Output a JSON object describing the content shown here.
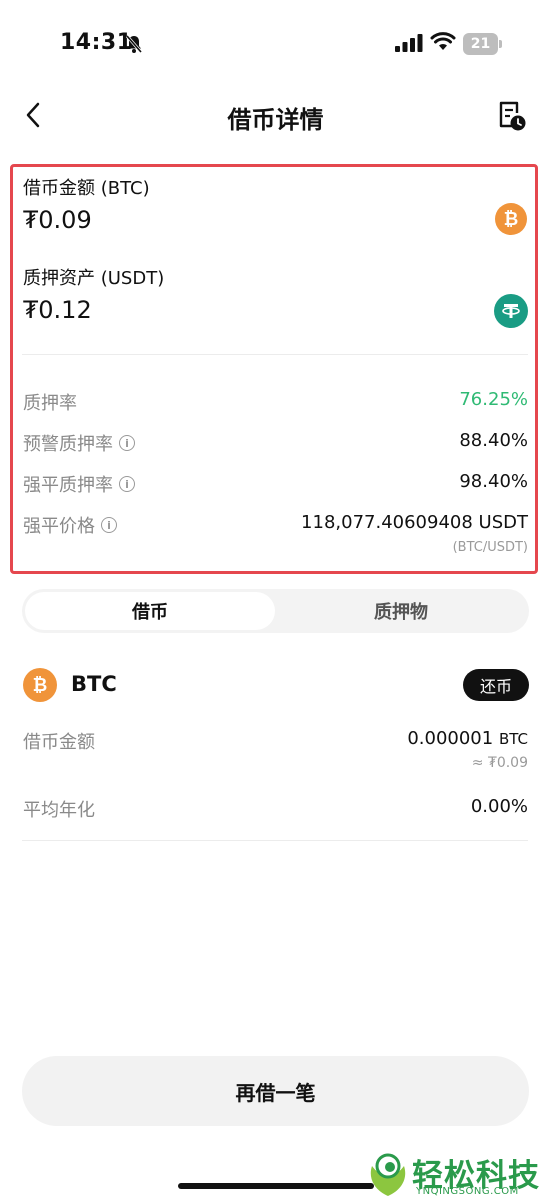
{
  "status_bar": {
    "time": "14:31",
    "battery": "21"
  },
  "nav": {
    "title": "借币详情"
  },
  "loan": {
    "borrow_label": "借币金额 (BTC)",
    "borrow_amount": "₮0.09",
    "collateral_label": "质押资产 (USDT)",
    "collateral_amount": "₮0.12"
  },
  "metrics": [
    {
      "label": "质押率",
      "value": "76.25%"
    },
    {
      "label": "预警质押率",
      "value": "88.40%"
    },
    {
      "label": "强平质押率",
      "value": "98.40%"
    },
    {
      "label": "强平价格",
      "value": "118,077.40609408 USDT",
      "note": "(BTC/USDT)"
    }
  ],
  "tabs": [
    {
      "label": "借币"
    },
    {
      "label": "质押物"
    }
  ],
  "asset": {
    "name": "BTC",
    "repay_label": "还币",
    "rows": [
      {
        "label": "借币金额",
        "value": "0.000001",
        "unit": "BTC",
        "note": "≈ ₮0.09"
      },
      {
        "label": "平均年化",
        "value": "0.00%"
      }
    ]
  },
  "bottom_button": "再借一笔",
  "watermark": {
    "text": "轻松科技",
    "sub": "YNQINGSONG.COM"
  },
  "colors": {
    "accent_green": "#2fba74",
    "highlight_red": "#e5474e",
    "btc_orange": "#f0943a",
    "usdt_teal": "#1a9c84"
  },
  "icons": [
    "bell-off-icon",
    "signal-icon",
    "wifi-icon",
    "battery-icon",
    "back-arrow-icon",
    "history-icon",
    "btc-icon",
    "usdt-icon",
    "info-icon"
  ]
}
